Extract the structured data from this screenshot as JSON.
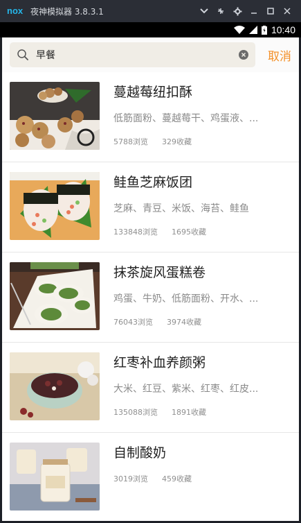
{
  "emulator": {
    "logo": "nox",
    "title": "夜神模拟器 3.8.3.1",
    "controls": [
      "chevron-down-icon",
      "pin-icon",
      "gear-icon",
      "minimize-icon",
      "maximize-icon",
      "close-icon"
    ]
  },
  "status_bar": {
    "time": "10:40"
  },
  "search": {
    "query": "早餐",
    "cancel_label": "取消"
  },
  "colors": {
    "accent": "#f39028",
    "text_primary": "#222222",
    "text_secondary": "#8a8a8a"
  },
  "recipes": [
    {
      "title": "蔓越莓纽扣酥",
      "ingredients": "低筋面粉、蔓越莓干、鸡蛋液、...",
      "views": "5788浏览",
      "favorites": "329收藏"
    },
    {
      "title": "鲑鱼芝麻饭团",
      "ingredients": "芝麻、青豆、米饭、海苔、鲑鱼",
      "views": "133848浏览",
      "favorites": "1695收藏"
    },
    {
      "title": "抹茶旋风蛋糕卷",
      "ingredients": "鸡蛋、牛奶、低筋面粉、开水、...",
      "views": "76043浏览",
      "favorites": "3974收藏"
    },
    {
      "title": "红枣补血养颜粥",
      "ingredients": "大米、红豆、紫米、红枣、红皮...",
      "views": "135088浏览",
      "favorites": "1891收藏"
    },
    {
      "title": "自制酸奶",
      "ingredients": "",
      "views": "3019浏览",
      "favorites": "459收藏"
    }
  ]
}
